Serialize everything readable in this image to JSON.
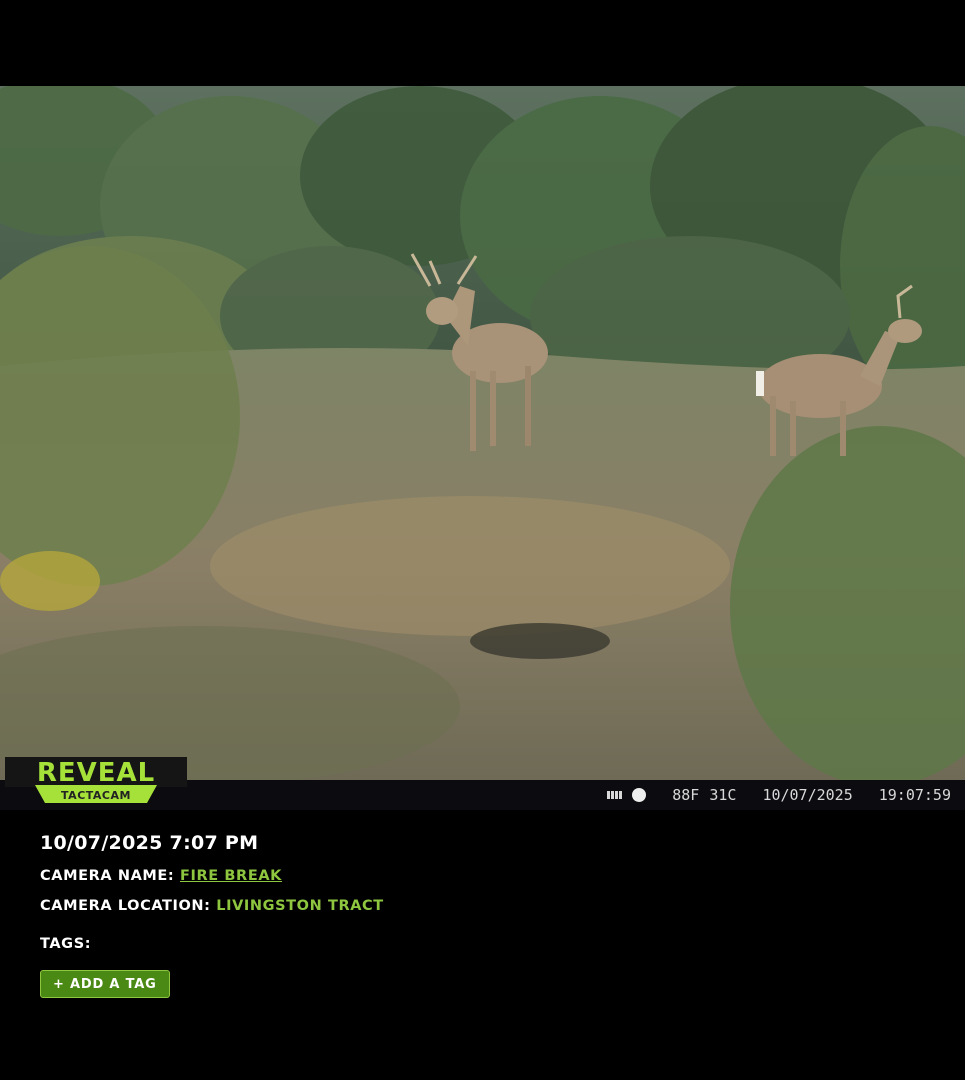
{
  "overlay": {
    "brand": "REVEAL",
    "subbrand": "TACTACAM",
    "temp_f": "88F",
    "temp_c": "31C",
    "date": "10/07/2025",
    "time": "19:07:59",
    "battery_icon": "battery-icon",
    "moon_icon": "moon-phase-icon"
  },
  "details": {
    "datetime": "10/07/2025 7:07 PM",
    "camera_name_label": "CAMERA NAME:",
    "camera_name": "FIRE BREAK",
    "camera_location_label": "CAMERA LOCATION:",
    "camera_location": "LIVINGSTON TRACT",
    "tags_label": "TAGS:",
    "add_tag_label": "+ ADD A TAG"
  },
  "colors": {
    "accent": "#8ec63f",
    "button_bg": "#4a8a14",
    "background": "#000000"
  }
}
